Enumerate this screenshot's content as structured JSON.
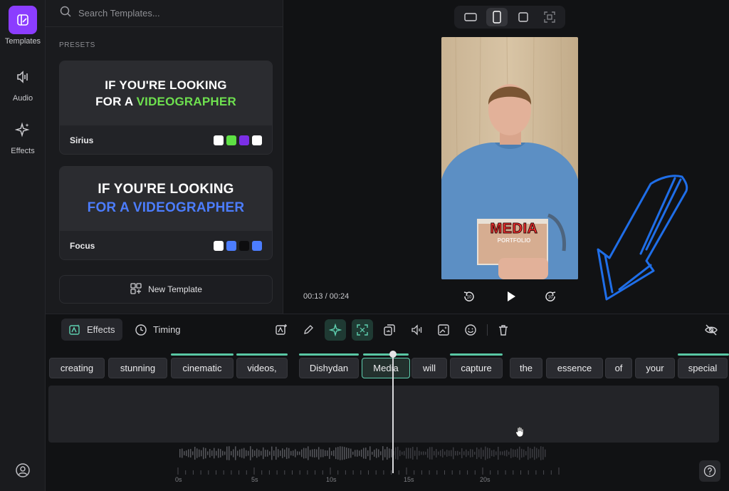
{
  "rail": {
    "items": [
      {
        "label": "Templates",
        "icon": "templates-icon"
      },
      {
        "label": "Audio",
        "icon": "audio-icon"
      },
      {
        "label": "Effects",
        "icon": "sparkle-icon"
      }
    ]
  },
  "templates": {
    "search_placeholder": "Search Templates...",
    "section_label": "PRESETS",
    "presets": [
      {
        "name": "Sirius",
        "line1": "IF YOU'RE LOOKING",
        "line2_prefix": "FOR A ",
        "line2_highlight": "VIDEOGRAPHER",
        "highlight_color": "#6ee04f",
        "swatches": [
          "#ffffff",
          "#5ee044",
          "#7b2fe6",
          "#ffffff"
        ]
      },
      {
        "name": "Focus",
        "line1": "IF YOU'RE LOOKING",
        "line2_prefix": "",
        "line2_highlight": "FOR A VIDEOGRAPHER",
        "highlight_color": "#4c7dff",
        "swatches": [
          "#ffffff",
          "#4c7dff",
          "#0d0d0f",
          "#4c7dff"
        ]
      }
    ],
    "new_template_label": "New Template"
  },
  "preview": {
    "time_current": "00:13",
    "time_total": "00:24",
    "time_separator": " / ",
    "caption_word": "MEDIA",
    "caption_sub": "PORTFOLIO",
    "rewind_label": "10",
    "forward_label": "10"
  },
  "toolbar": {
    "effects_tab": "Effects",
    "timing_tab": "Timing"
  },
  "words": [
    "creating",
    "stunning",
    "cinematic",
    "videos,",
    "Dishydan",
    "Media",
    "will",
    "capture",
    "the",
    "essence",
    "of",
    "your",
    "special"
  ],
  "selected_word": "Media",
  "ruler": [
    "0s",
    "5s",
    "10s",
    "15s",
    "20s"
  ],
  "colors": {
    "accent": "#8b3dff",
    "teal": "#5fd0b0",
    "annotation_blue": "#1f6ee8"
  }
}
